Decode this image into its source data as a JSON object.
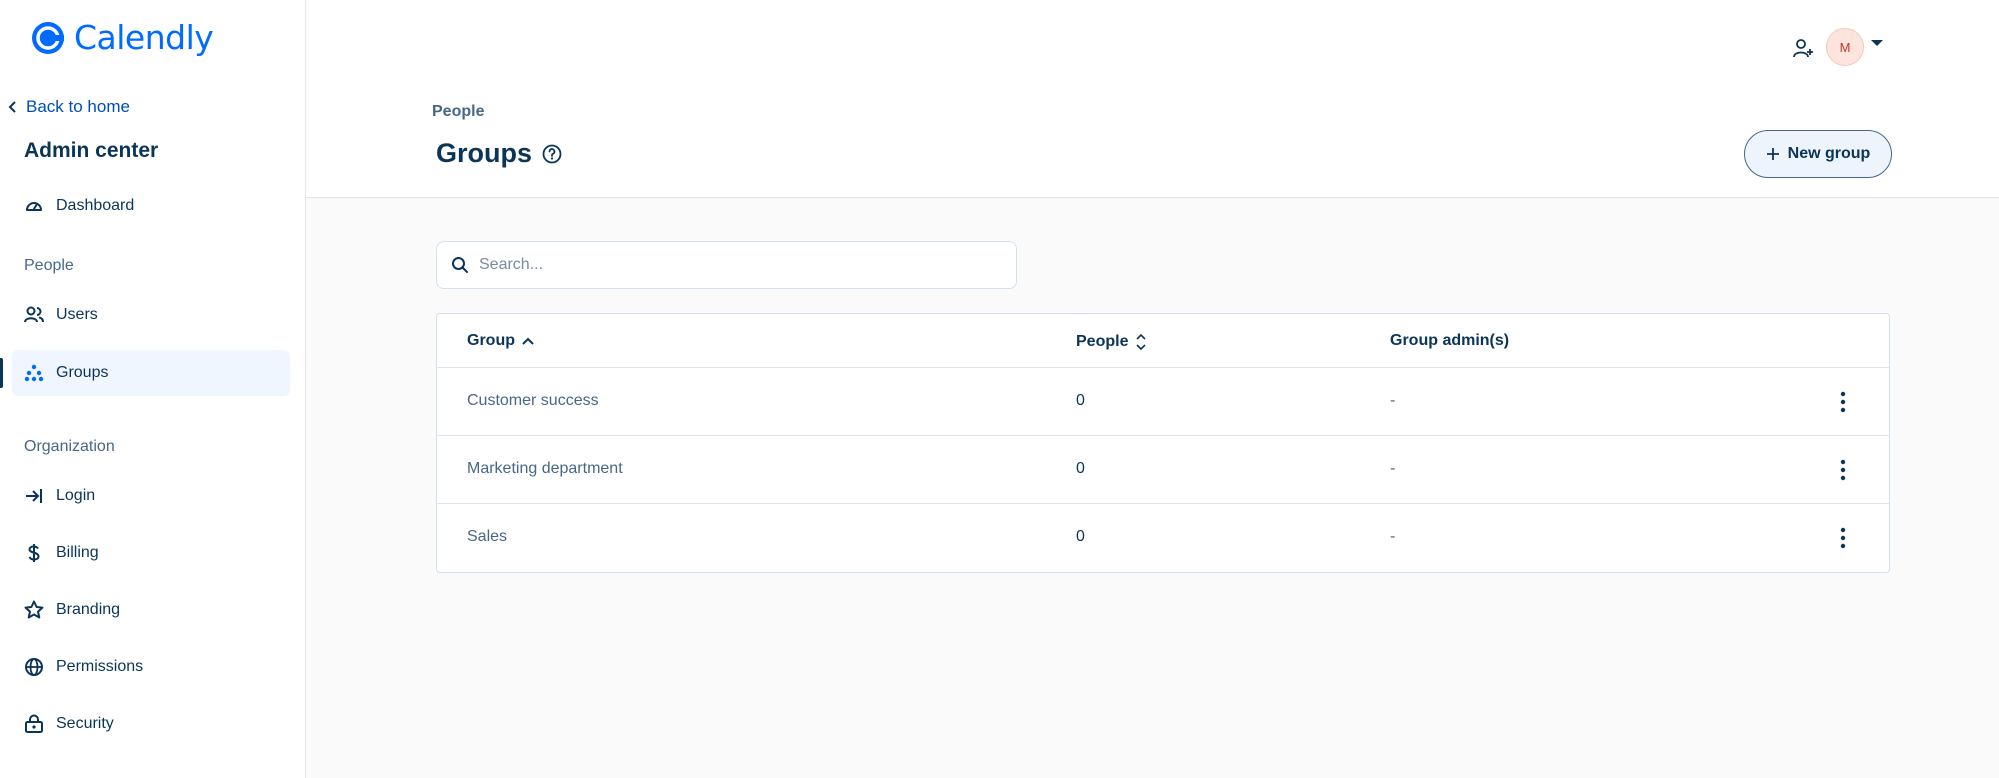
{
  "brand": {
    "name": "Calendly",
    "color": "#006bff"
  },
  "sidebar": {
    "back_label": "Back to home",
    "title": "Admin center",
    "dashboard": {
      "label": "Dashboard",
      "icon": "gauge-icon"
    },
    "people_section": "People",
    "users": {
      "label": "Users",
      "icon": "users-icon"
    },
    "groups": {
      "label": "Groups",
      "icon": "groups-icon",
      "active": true
    },
    "organization_section": "Organization",
    "login": {
      "label": "Login",
      "icon": "login-arrow-icon"
    },
    "billing": {
      "label": "Billing",
      "icon": "dollar-icon"
    },
    "branding": {
      "label": "Branding",
      "icon": "star-icon"
    },
    "permissions": {
      "label": "Permissions",
      "icon": "globe-icon"
    },
    "security": {
      "label": "Security",
      "icon": "lock-icon"
    }
  },
  "header": {
    "breadcrumb": "People",
    "title": "Groups",
    "new_group_label": "New group",
    "avatar_initial": "M"
  },
  "search": {
    "placeholder": "Search..."
  },
  "table": {
    "columns": {
      "group": "Group",
      "people": "People",
      "admins": "Group admin(s)"
    },
    "rows": [
      {
        "name": "Customer success",
        "people": "0",
        "admins": "-"
      },
      {
        "name": "Marketing department",
        "people": "0",
        "admins": "-"
      },
      {
        "name": "Sales",
        "people": "0",
        "admins": "-"
      }
    ]
  }
}
